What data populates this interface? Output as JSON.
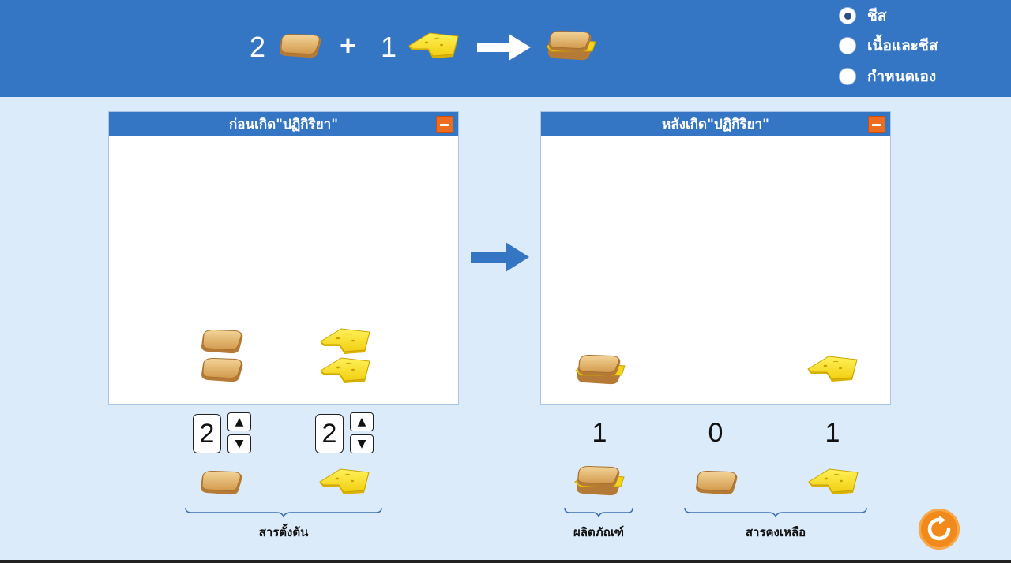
{
  "header": {
    "equation": {
      "bread_count": "2",
      "plus": "+",
      "cheese_count": "1"
    },
    "options": [
      {
        "label": "ชีส",
        "selected": true
      },
      {
        "label": "เนื้อและชีส",
        "selected": false
      },
      {
        "label": "กำหนดเอง",
        "selected": false
      }
    ]
  },
  "before_panel": {
    "title": "ก่อนเกิด\"ปฏิกิริยา\"",
    "bread_pieces": 2,
    "cheese_pieces": 2
  },
  "after_panel": {
    "title": "หลังเกิด\"ปฏิกิริยา\"",
    "sandwich_pieces": 1,
    "cheese_pieces": 1
  },
  "reactants": {
    "bread_count": "2",
    "cheese_count": "2",
    "label": "สารตั้งต้น"
  },
  "products": {
    "sandwich_count": "1",
    "bread_left": "0",
    "cheese_left": "1",
    "product_label": "ผลิตภัณฑ์",
    "leftover_label": "สารคงเหลือ"
  },
  "colors": {
    "header": "#3475c4",
    "background": "#dcebfa",
    "minimize": "#ef6c1f",
    "reset": "#f28a1b"
  },
  "icons": [
    "bread-slice-icon",
    "cheese-slice-icon",
    "sandwich-icon",
    "arrow-right-icon",
    "minimize-icon",
    "reset-icon"
  ]
}
